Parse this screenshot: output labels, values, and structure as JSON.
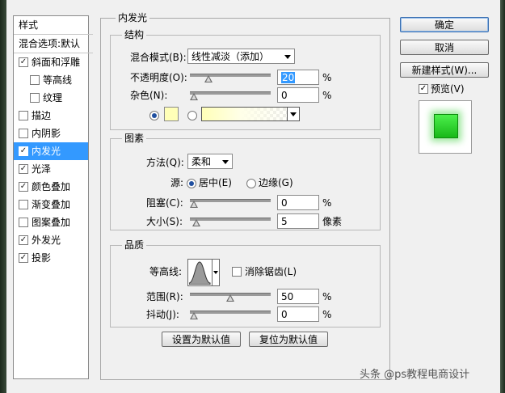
{
  "sidebar": {
    "header": "样式",
    "blend_default": "混合选项:默认",
    "items": [
      {
        "label": "斜面和浮雕",
        "checked": true,
        "indent": 0
      },
      {
        "label": "等高线",
        "checked": false,
        "indent": 1
      },
      {
        "label": "纹理",
        "checked": false,
        "indent": 1
      },
      {
        "label": "描边",
        "checked": false,
        "indent": 0
      },
      {
        "label": "内阴影",
        "checked": false,
        "indent": 0
      },
      {
        "label": "内发光",
        "checked": true,
        "indent": 0,
        "selected": true
      },
      {
        "label": "光泽",
        "checked": true,
        "indent": 0
      },
      {
        "label": "颜色叠加",
        "checked": true,
        "indent": 0
      },
      {
        "label": "渐变叠加",
        "checked": false,
        "indent": 0
      },
      {
        "label": "图案叠加",
        "checked": false,
        "indent": 0
      },
      {
        "label": "外发光",
        "checked": true,
        "indent": 0
      },
      {
        "label": "投影",
        "checked": true,
        "indent": 0
      }
    ]
  },
  "panel": {
    "title": "内发光",
    "structure": {
      "title": "结构",
      "blend_mode_label": "混合模式(B):",
      "blend_mode_value": "线性减淡（添加）",
      "opacity_label": "不透明度(O):",
      "opacity_value": "20",
      "opacity_fraction": 0.2,
      "noise_label": "杂色(N):",
      "noise_value": "0",
      "noise_fraction": 0.0,
      "percent": "%",
      "color_swatch": "#ffffb8"
    },
    "elements": {
      "title": "图素",
      "technique_label": "方法(Q):",
      "technique_value": "柔和",
      "source_label": "源:",
      "center_label": "居中(E)",
      "edge_label": "边缘(G)",
      "choke_label": "阻塞(C):",
      "choke_value": "0",
      "choke_fraction": 0.0,
      "size_label": "大小(S):",
      "size_value": "5",
      "size_unit": "像素",
      "size_fraction": 0.03
    },
    "quality": {
      "title": "品质",
      "contour_label": "等高线:",
      "antialias_label": "消除锯齿(L)",
      "range_label": "范围(R):",
      "range_value": "50",
      "range_fraction": 0.5,
      "jitter_label": "抖动(J):",
      "jitter_value": "0",
      "jitter_fraction": 0.0
    },
    "make_default": "设置为默认值",
    "reset_default": "复位为默认值"
  },
  "buttons": {
    "ok": "确定",
    "cancel": "取消",
    "new_style": "新建样式(W)...",
    "preview": "预览(V)"
  },
  "watermark": "头条 @ps教程电商设计",
  "colors": {
    "selection": "#3399ff",
    "preview_green": "#22cc22"
  }
}
